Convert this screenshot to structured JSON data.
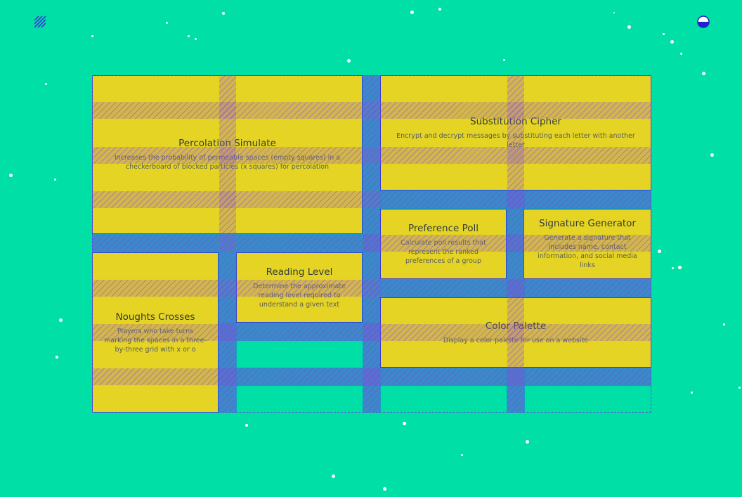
{
  "colors": {
    "background": "#00e0a6",
    "card": "#e6d424",
    "border": "#3b3bd6",
    "gap": "#2882d2"
  },
  "header": {
    "left_icon": "hatch-icon",
    "right_icon": "half-circle-icon"
  },
  "cards": [
    {
      "id": "percolation",
      "title": "Percolation Simulate",
      "desc": "Increases the probability of permeable spaces (empty squares) in a checkerboard of blocked particles (x squares) for percolation"
    },
    {
      "id": "substitution",
      "title": "Substitution Cipher",
      "desc": "Encrypt and decrypt messages by substituting each letter with another letter"
    },
    {
      "id": "preference",
      "title": "Preference Poll",
      "desc": "Calculate poll results that represent the ranked preferences of a group"
    },
    {
      "id": "signature",
      "title": "Signature Generator",
      "desc": "Generate a signature that includes name, contact information, and social media links"
    },
    {
      "id": "noughts",
      "title": "Noughts Crosses",
      "desc": "Players who take turns marking the spaces in a three-by-three grid with x or o"
    },
    {
      "id": "reading",
      "title": "Reading Level",
      "desc": "Determine the approximate reading level required to understand a given text"
    },
    {
      "id": "palette",
      "title": "Color Palette",
      "desc": "Display a color palette for use on a website"
    }
  ]
}
